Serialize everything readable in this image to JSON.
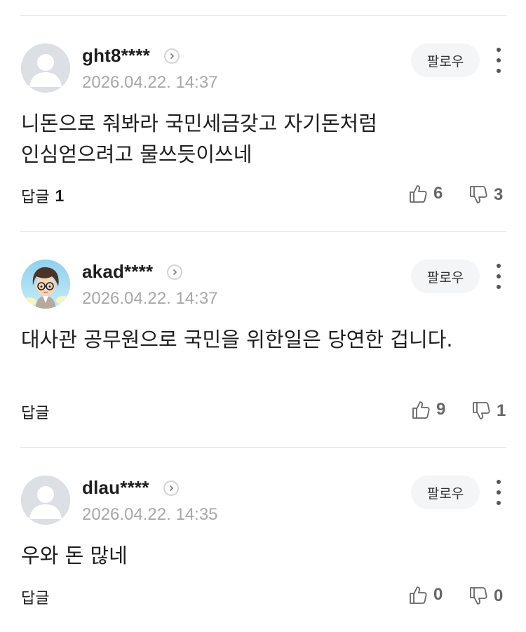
{
  "follow_label": "팔로우",
  "reply_label": "답글",
  "comments": [
    {
      "username": "ght8****",
      "timestamp": "2026.04.22. 14:37",
      "text": "니돈으로 줘봐라 국민세금갖고 자기돈처럼 인심얻으려고 물쓰듯이쓰네",
      "reply_count": "1",
      "likes": "6",
      "dislikes": "3",
      "avatar": "default-avatar-icon"
    },
    {
      "username": "akad****",
      "timestamp": "2026.04.22. 14:37",
      "text": "대사관 공무원으로 국민을 위한일은 당연한 겁니다.",
      "reply_count": "",
      "likes": "9",
      "dislikes": "1",
      "avatar": "character-avatar-icon"
    },
    {
      "username": "dlau****",
      "timestamp": "2026.04.22. 14:35",
      "text": "우와 돈 많네",
      "reply_count": "",
      "likes": "0",
      "dislikes": "0",
      "avatar": "default-avatar-icon"
    }
  ]
}
